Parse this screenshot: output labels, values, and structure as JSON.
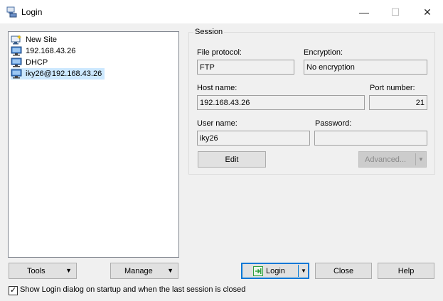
{
  "window": {
    "title": "Login",
    "minimize_glyph": "—",
    "maximize_glyph": "☐",
    "close_glyph": "✕"
  },
  "sites": [
    {
      "label": "New Site",
      "icon": "new-site-icon"
    },
    {
      "label": "192.168.43.26",
      "icon": "computer-icon"
    },
    {
      "label": "DHCP",
      "icon": "computer-icon"
    },
    {
      "label": "iky26@192.168.43.26",
      "icon": "computer-icon",
      "selected": true
    }
  ],
  "session": {
    "legend": "Session",
    "file_protocol_label": "File protocol:",
    "file_protocol_value": "FTP",
    "encryption_label": "Encryption:",
    "encryption_value": "No encryption",
    "host_name_label": "Host name:",
    "host_name_value": "192.168.43.26",
    "port_number_label": "Port number:",
    "port_number_value": "21",
    "user_name_label": "User name:",
    "user_name_value": "iky26",
    "password_label": "Password:",
    "password_value": "",
    "edit_label": "Edit",
    "advanced_label": "Advanced..."
  },
  "buttons": {
    "tools": "Tools",
    "manage": "Manage",
    "login": "Login",
    "close": "Close",
    "help": "Help",
    "dropdown_glyph": "▼"
  },
  "startup_checkbox": {
    "label": "Show Login dialog on startup and when the last session is closed",
    "checked": true,
    "check_glyph": "✓"
  },
  "colors": {
    "selection": "#cce8ff",
    "default_button_border": "#0078d7",
    "login_icon_green": "#2e9e3e"
  }
}
